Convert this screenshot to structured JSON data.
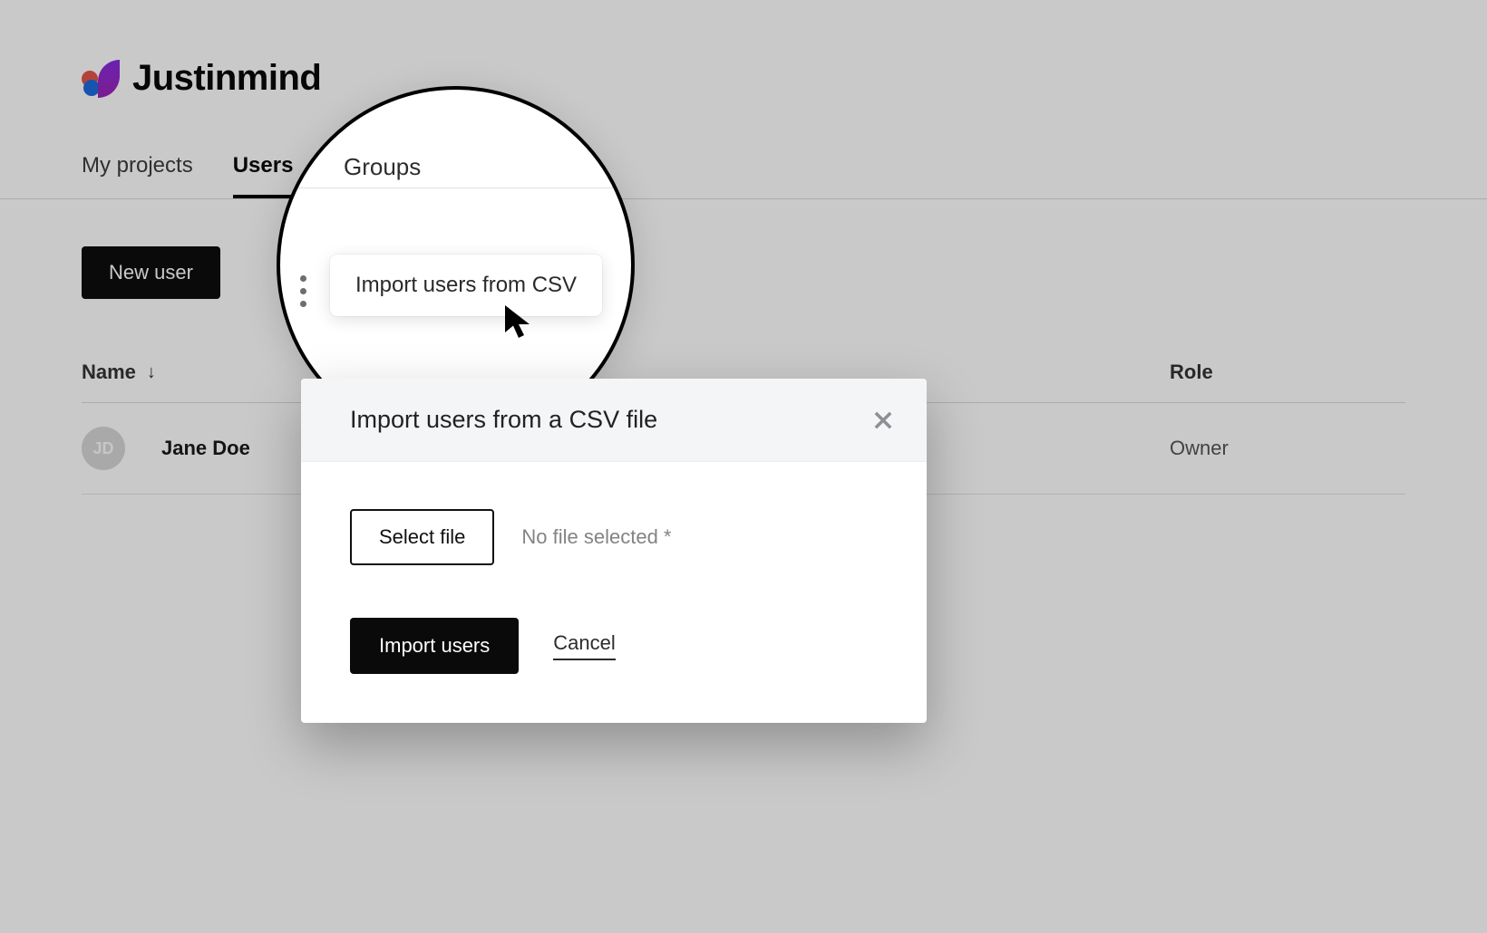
{
  "brand": {
    "name": "Justinmind"
  },
  "tabs": {
    "my_projects": "My projects",
    "users": "Users",
    "groups": "Groups"
  },
  "toolbar": {
    "new_user_label": "New user"
  },
  "magnifier": {
    "tab_label": "Groups",
    "menu_item": "Import users from CSV"
  },
  "table": {
    "headers": {
      "name": "Name",
      "role": "Role"
    },
    "rows": [
      {
        "initials": "JD",
        "name": "Jane Doe",
        "role": "Owner"
      }
    ]
  },
  "modal": {
    "title": "Import users from a CSV file",
    "select_file_label": "Select file",
    "no_file_hint": "No file selected *",
    "import_label": "Import users",
    "cancel_label": "Cancel"
  }
}
